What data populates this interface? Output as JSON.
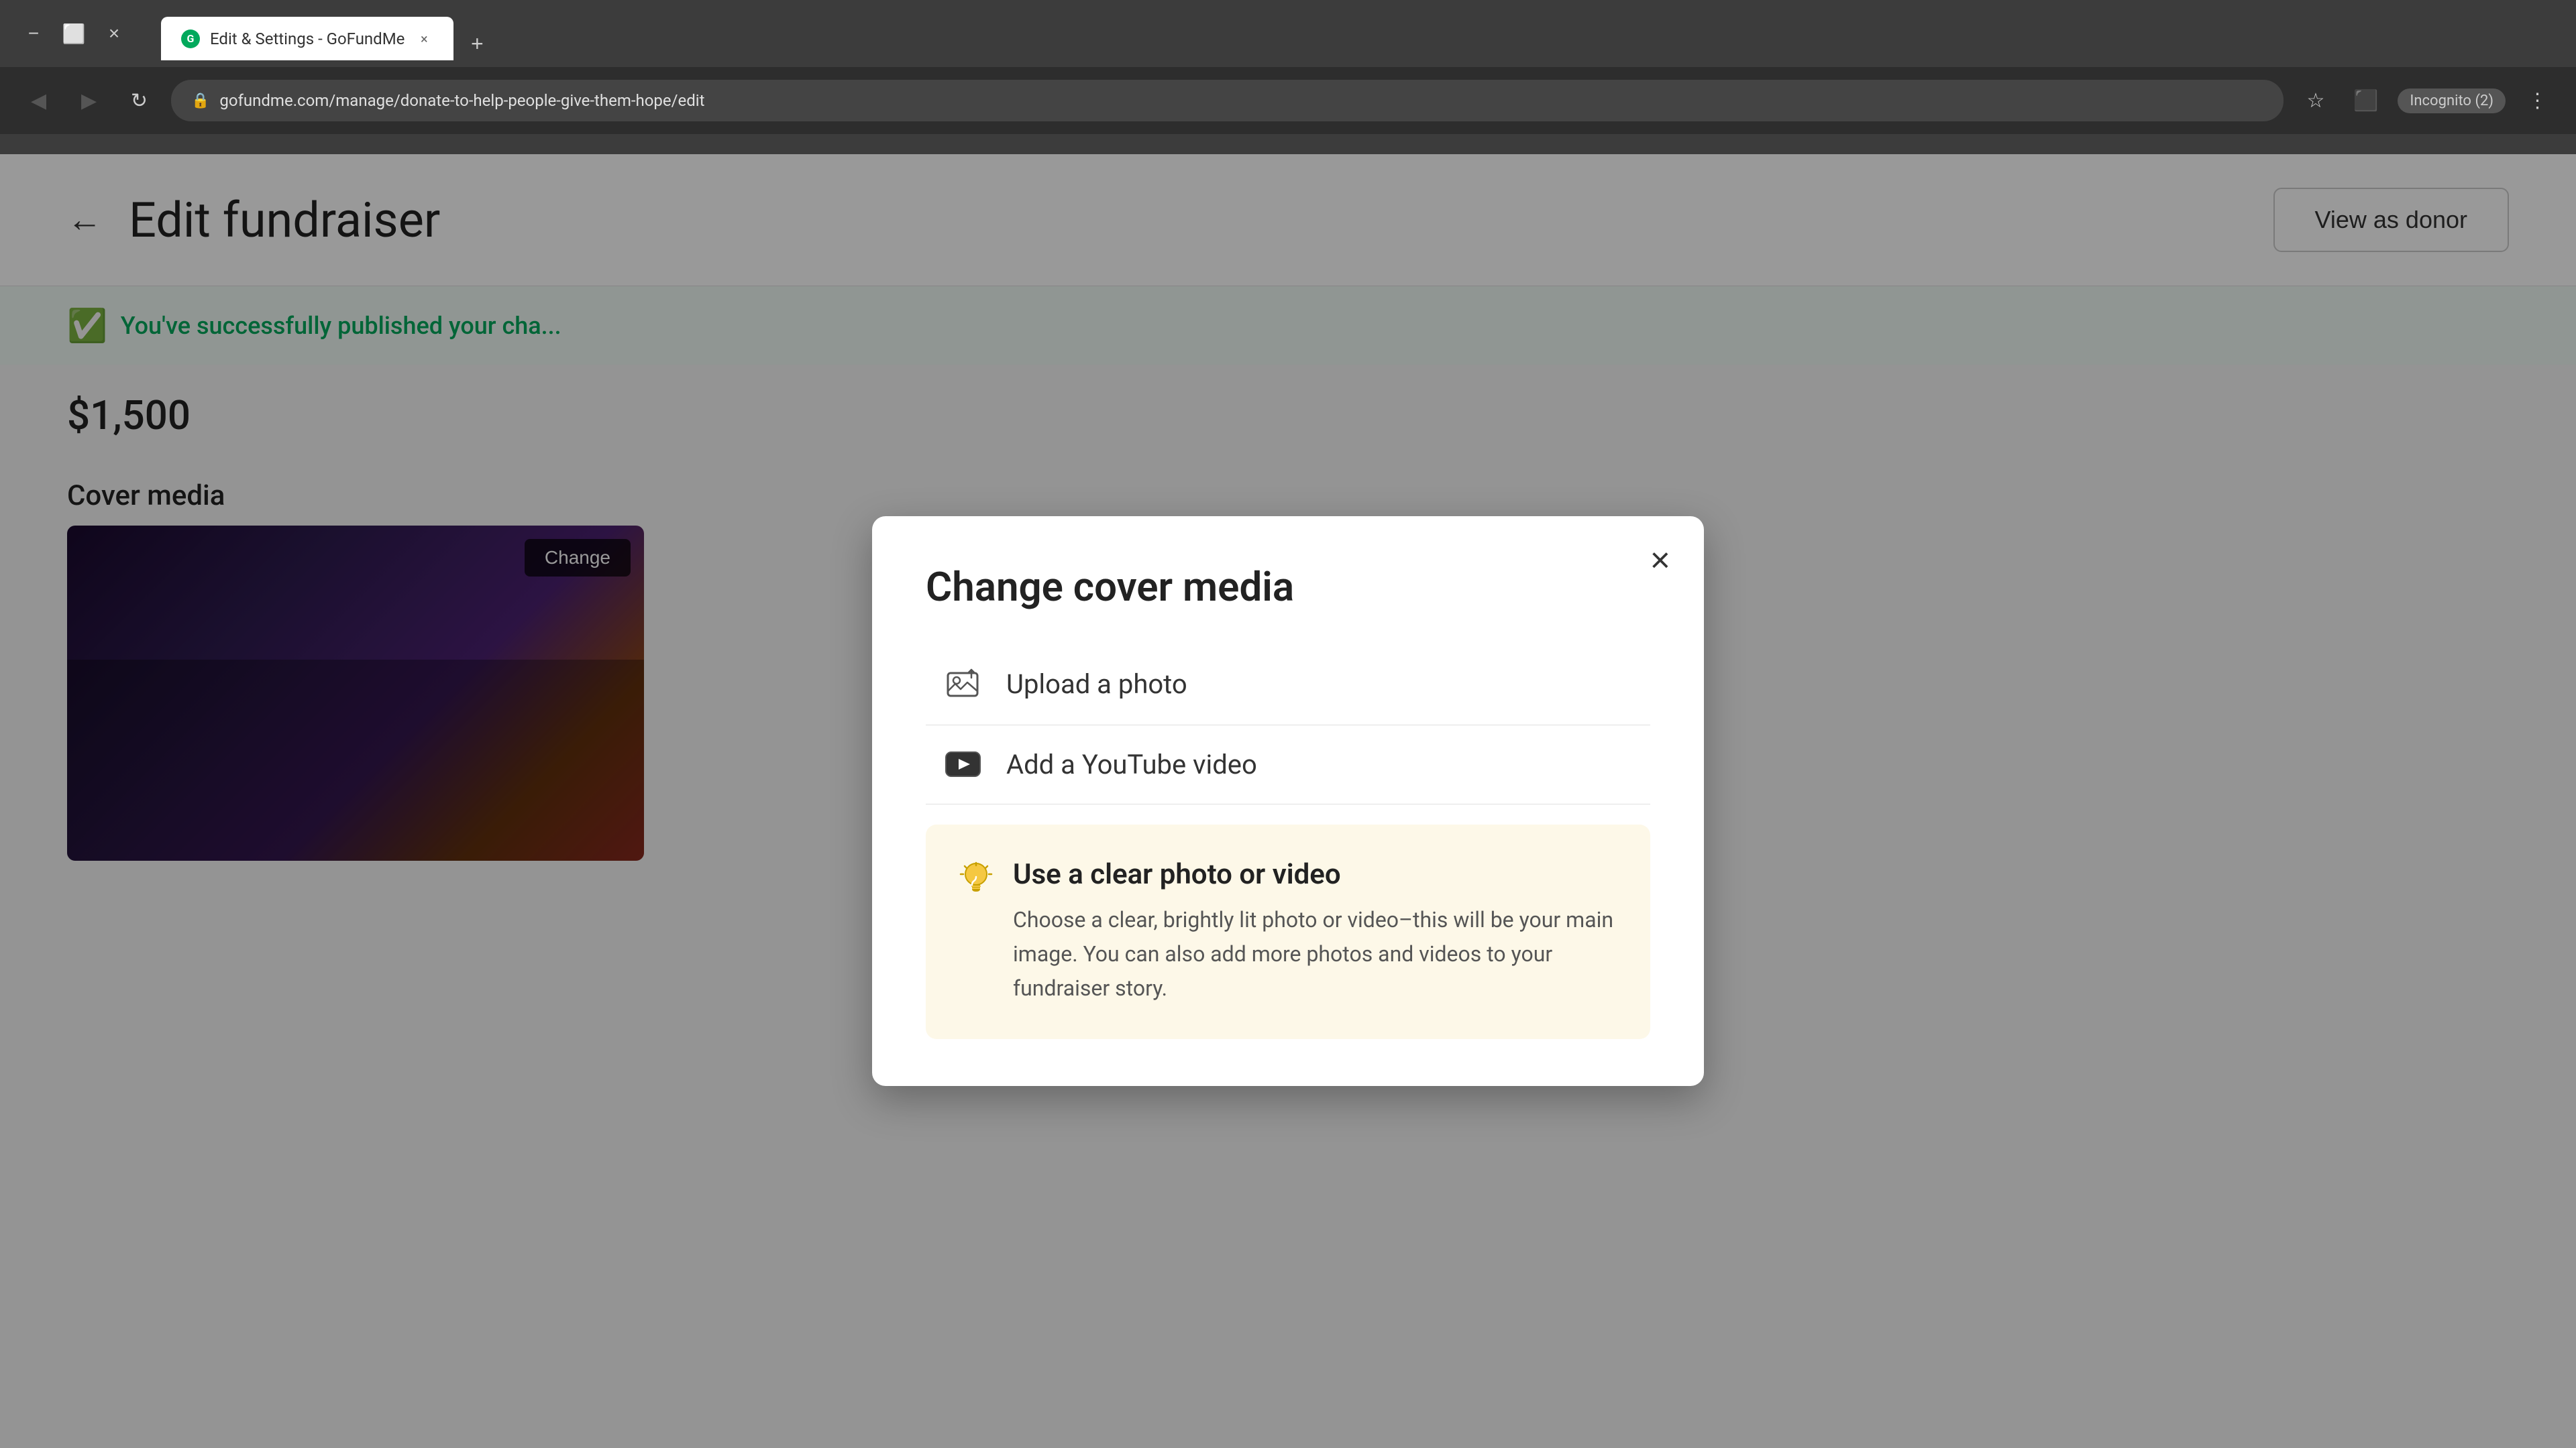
{
  "browser": {
    "tab_title": "Edit & Settings - GoFundMe",
    "tab_close": "×",
    "tab_add": "+",
    "address": "gofundme.com/manage/donate-to-help-people-give-them-hope/edit",
    "incognito_label": "Incognito (2)"
  },
  "page": {
    "back_label": "←",
    "title": "Edit fundraiser",
    "view_as_donor_label": "View as donor"
  },
  "success_banner": {
    "text": "You've successfully published your cha..."
  },
  "amount": {
    "value": "$1,500"
  },
  "cover_media": {
    "label": "Cover media",
    "change_label": "Change"
  },
  "modal": {
    "title": "Change cover media",
    "close_label": "×",
    "option_upload_label": "Upload a photo",
    "option_youtube_label": "Add a YouTube video",
    "tip_title": "Use a clear photo or video",
    "tip_description": "Choose a clear, brightly lit photo or video–this will be your main image. You can also add more photos and videos to your fundraiser story."
  }
}
